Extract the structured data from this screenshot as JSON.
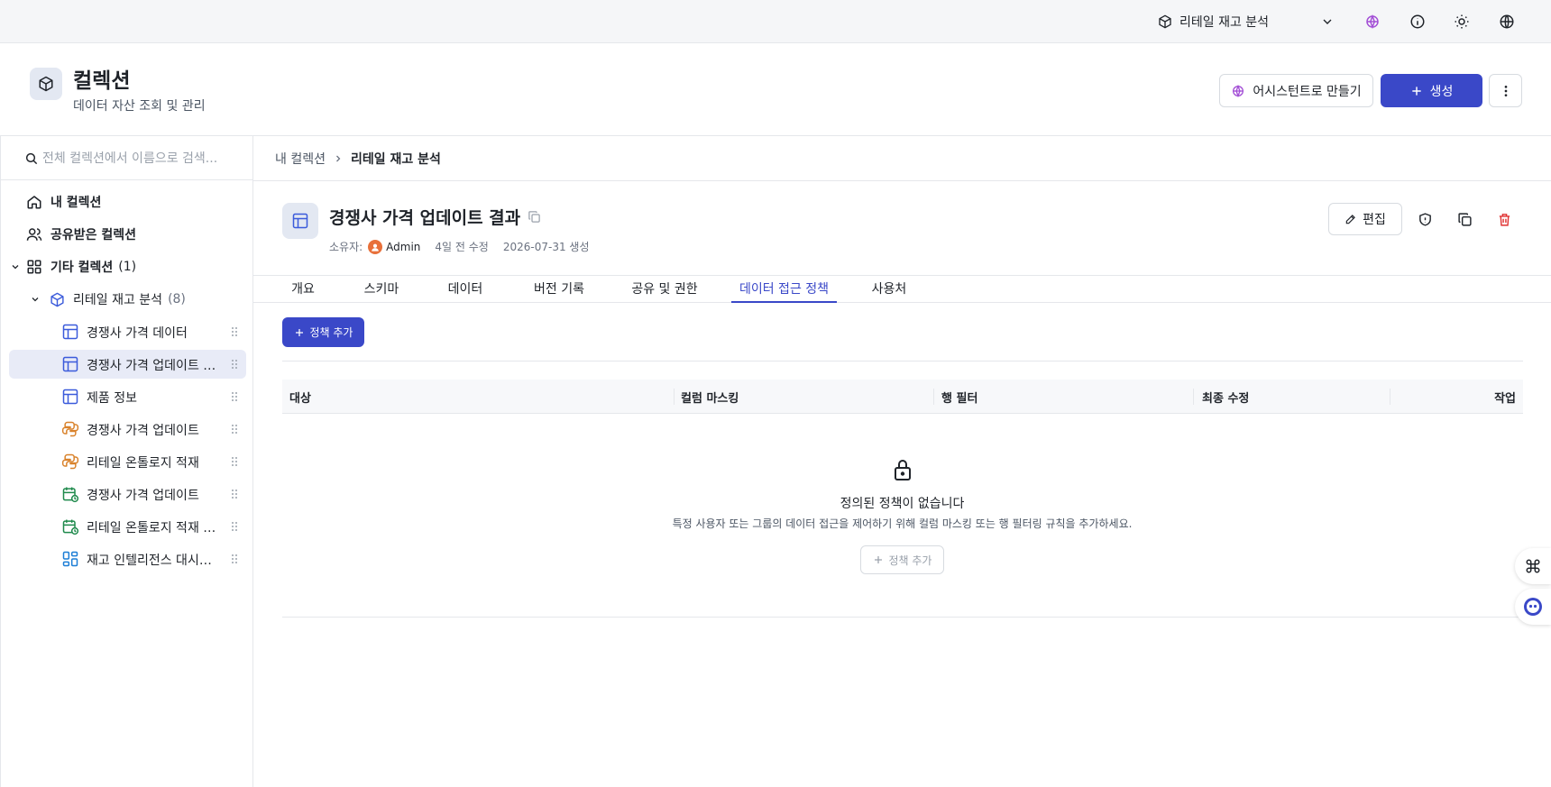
{
  "topbar": {
    "workspace": "리테일 재고 분석",
    "icons": [
      "cube-icon",
      "chevron-down-icon",
      "ai-icon",
      "info-icon",
      "sun-icon",
      "globe-icon"
    ]
  },
  "page_header": {
    "title": "컬렉션",
    "subtitle": "데이터 자산 조회 및 관리",
    "assist_button": "어시스턴트로 만들기",
    "create_button": "생성"
  },
  "sidebar": {
    "search_placeholder": "전체 컬렉션에서 이름으로 검색...",
    "nav": {
      "my_collections": "내 컬렉션",
      "shared": "공유받은 컬렉션",
      "other": "기타 컬렉션",
      "other_count": "(1)"
    },
    "collection": {
      "name": "리테일 재고 분석",
      "count": "(8)"
    },
    "items": [
      {
        "label": "경쟁사 가격 데이터",
        "icon": "table-icon"
      },
      {
        "label": "경쟁사 가격 업데이트 결과",
        "icon": "table-icon"
      },
      {
        "label": "제품 정보",
        "icon": "table-icon"
      },
      {
        "label": "경쟁사 가격 업데이트",
        "icon": "python-icon"
      },
      {
        "label": "리테일 온톨로지 적재",
        "icon": "python-icon"
      },
      {
        "label": "경쟁사 가격 업데이트",
        "icon": "schedule-icon"
      },
      {
        "label": "리테일 온톨로지 적재 파이프라인",
        "icon": "schedule-icon"
      },
      {
        "label": "재고 인텔리전스 대시보드",
        "icon": "dashboard-icon"
      }
    ]
  },
  "breadcrumb": {
    "root": "내 컬렉션",
    "current": "리테일 재고 분석"
  },
  "asset": {
    "title": "경쟁사 가격 업데이트 결과",
    "owner_label": "소유자:",
    "owner": "Admin",
    "modified": "4일 전 수정",
    "created": "2026-07-31 생성",
    "edit_button": "편집"
  },
  "tabs": [
    "개요",
    "스키마",
    "데이터",
    "버전 기록",
    "공유 및 권한",
    "데이터 접근 정책",
    "사용처"
  ],
  "active_tab": "데이터 접근 정책",
  "policy": {
    "add_button": "정책 추가",
    "columns": [
      "대상",
      "컬럼 마스킹",
      "행 필터",
      "최종 수정",
      "작업"
    ],
    "empty_title": "정의된 정책이 없습니다",
    "empty_desc": "특정 사용자 또는 그룹의 데이터 접근을 제어하기 위해 컬럼 마스킹 또는 행 필터링 규칙을 추가하세요.",
    "empty_add_button": "정책 추가"
  },
  "colors": {
    "primary": "#3a48c8",
    "active_bg": "#e8ebf7",
    "table_icon": "#3b5bdb",
    "python_icon": "#d9822b",
    "schedule_icon": "#1f8a4c",
    "danger": "#e03131",
    "ai": "#a34fd6"
  }
}
